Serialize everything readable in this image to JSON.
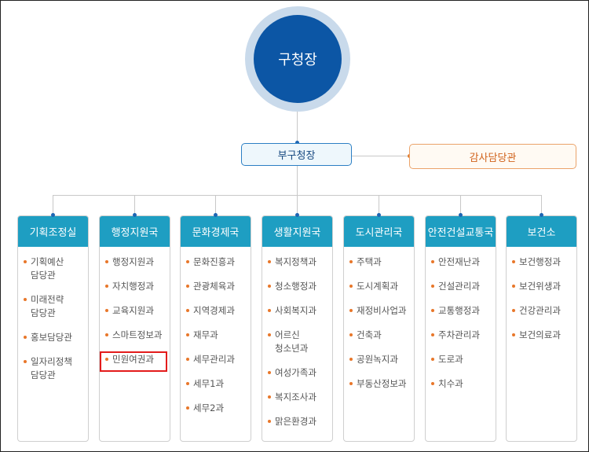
{
  "top": {
    "mayor": "구청장",
    "deputy": "부구청장",
    "audit": "감사담당관"
  },
  "colors": {
    "mayor": "#0c56a5",
    "dept_header": "#1e9ec2",
    "bullet": "#e8772a",
    "highlight": "#e31b1b"
  },
  "departments": [
    {
      "name": "기획조정실",
      "items": [
        "기획예산\n담당관",
        "미래전략\n담당관",
        "홍보담당관",
        "일자리정책\n담당관"
      ]
    },
    {
      "name": "행정지원국",
      "items": [
        "행정지원과",
        "자치행정과",
        "교육지원과",
        "스마트정보과",
        "민원여권과"
      ]
    },
    {
      "name": "문화경제국",
      "items": [
        "문화진흥과",
        "관광체육과",
        "지역경제과",
        "재무과",
        "세무관리과",
        "세무1과",
        "세무2과"
      ]
    },
    {
      "name": "생활지원국",
      "items": [
        "복지정책과",
        "청소행정과",
        "사회복지과",
        "어르신\n청소년과",
        "여성가족과",
        "복지조사과",
        "맑은환경과"
      ]
    },
    {
      "name": "도시관리국",
      "items": [
        "주택과",
        "도시계획과",
        "재정비사업과",
        "건축과",
        "공원녹지과",
        "부동산정보과"
      ]
    },
    {
      "name": "안전건설교통국",
      "items": [
        "안전재난과",
        "건설관리과",
        "교통행정과",
        "주차관리과",
        "도로과",
        "치수과"
      ]
    },
    {
      "name": "보건소",
      "items": [
        "보건행정과",
        "보건위생과",
        "건강관리과",
        "보건의료과"
      ]
    }
  ]
}
